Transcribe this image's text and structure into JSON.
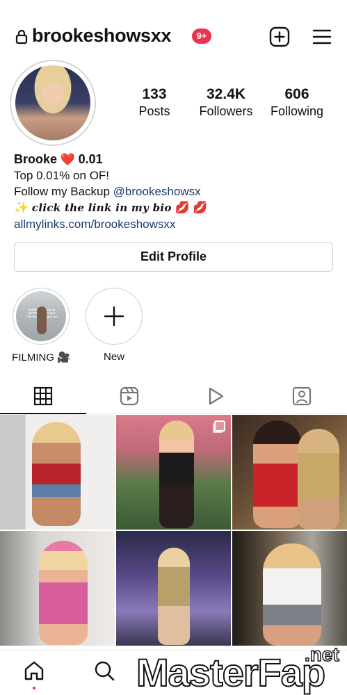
{
  "header": {
    "username": "brookeshowsxx",
    "notification_badge": "9+",
    "icons": [
      "lock-icon",
      "create-post-icon",
      "menu-icon"
    ]
  },
  "stats": {
    "posts_count": "133",
    "posts_label": "Posts",
    "followers_count": "32.4K",
    "followers_label": "Followers",
    "following_count": "606",
    "following_label": "Following"
  },
  "bio": {
    "name": "Brooke",
    "name_emoji": "❤️",
    "name_suffix": "0.01",
    "line1": "Top 0.01% on OF!",
    "line2_prefix": "Follow my Backup",
    "line2_handle": "@brookeshowsx",
    "line3_sparkle": "✨",
    "line3_text": "click the link in my bio",
    "line3_lips": "💋 💋",
    "link": "allmylinks.com/brookeshowsxx"
  },
  "edit_profile_label": "Edit Profile",
  "highlights": [
    {
      "label": "FILMING 🎥",
      "cover_caption": "WHEN THE POOL IS GETTING BUILT BUT THE FILMING MUST GO ON"
    },
    {
      "label": "New"
    }
  ],
  "tabs": [
    "grid-icon",
    "reels-icon",
    "video-play-icon",
    "tagged-icon"
  ],
  "bottom_nav": [
    "home-icon",
    "search-icon"
  ],
  "watermark": {
    "main": "Master",
    "fap": "Fap",
    "net": ".net"
  },
  "colors": {
    "badge": "#e8344f",
    "link": "#1b3c6b",
    "heart": "#c62828"
  }
}
